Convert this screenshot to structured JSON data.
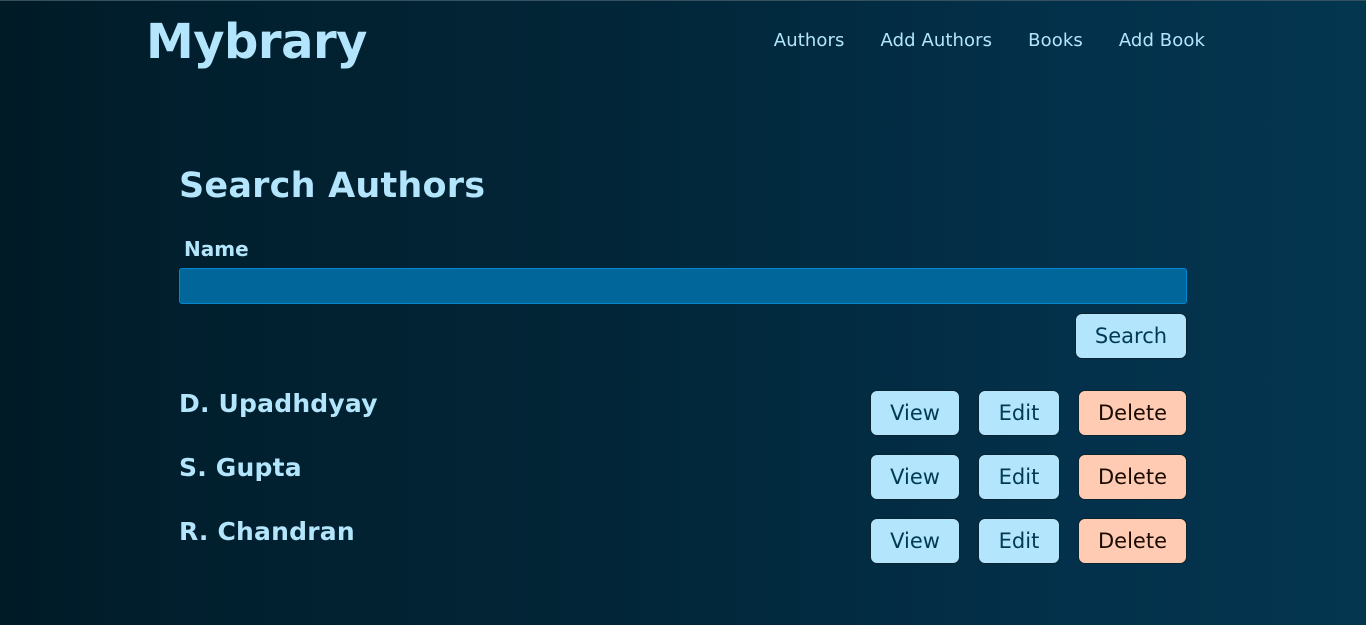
{
  "app": {
    "logo": "Mybrary"
  },
  "nav": {
    "items": [
      {
        "label": "Authors"
      },
      {
        "label": "Add Authors"
      },
      {
        "label": "Books"
      },
      {
        "label": "Add Book"
      }
    ]
  },
  "search": {
    "title": "Search Authors",
    "name_label": "Name",
    "name_value": "",
    "name_placeholder": "",
    "button_label": "Search"
  },
  "actions": {
    "view_label": "View",
    "edit_label": "Edit",
    "delete_label": "Delete"
  },
  "authors": [
    {
      "name": "D. Upadhdyay"
    },
    {
      "name": "S. Gupta"
    },
    {
      "name": "R. Chandran"
    }
  ],
  "colors": {
    "accent": "#b3e5fc",
    "input_bg": "#016699",
    "danger": "#ffccb3",
    "background_dark": "#001a26",
    "background_light": "#04364f"
  }
}
